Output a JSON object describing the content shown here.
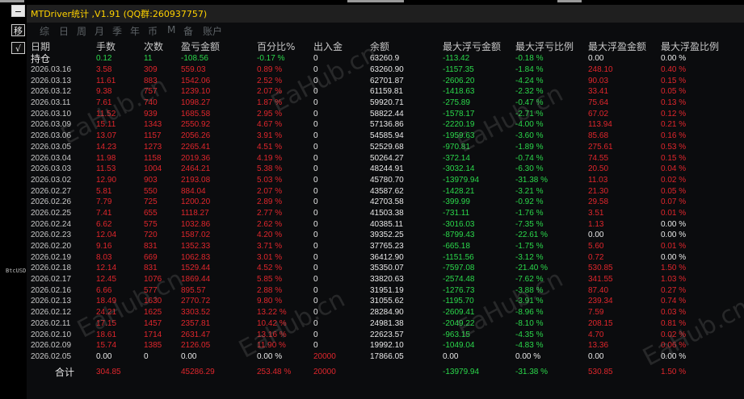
{
  "window": {
    "title": "MTDriver统计 ,V1.91 (QQ群:260937757)",
    "left_buttons": [
      "−",
      "移",
      "√"
    ]
  },
  "tabs": [
    "综",
    "日",
    "周",
    "月",
    "季",
    "年",
    "币",
    "M",
    "备",
    "账户"
  ],
  "columns": [
    "日期",
    "手数",
    "次数",
    "盈亏金额",
    "百分比%",
    "出入金",
    "余额",
    "最大浮亏金额",
    "最大浮亏比例",
    "最大浮盈金额",
    "最大浮盈比例"
  ],
  "holding": {
    "label": "持仓",
    "lots": "0.12",
    "count": "11",
    "pnl": "-108.56",
    "pct": "-0.17 %",
    "inout": "0",
    "balance": "63260.9",
    "max_loss": "-113.42",
    "max_loss_pct": "-0.18 %",
    "max_profit": "0.00",
    "max_profit_pct": "0.00 %"
  },
  "rows": [
    {
      "date": "2026.03.16",
      "lots": "3.58",
      "count": "309",
      "pnl": "559.03",
      "pct": "0.89 %",
      "inout": "0",
      "balance": "63260.90",
      "max_loss": "-1157.35",
      "max_loss_pct": "-1.84 %",
      "max_profit": "248.10",
      "max_profit_pct": "0.40 %"
    },
    {
      "date": "2026.03.13",
      "lots": "11.61",
      "count": "883",
      "pnl": "1542.06",
      "pct": "2.52 %",
      "inout": "0",
      "balance": "62701.87",
      "max_loss": "-2606.20",
      "max_loss_pct": "-4.24 %",
      "max_profit": "90.03",
      "max_profit_pct": "0.15 %"
    },
    {
      "date": "2026.03.12",
      "lots": "9.38",
      "count": "757",
      "pnl": "1239.10",
      "pct": "2.07 %",
      "inout": "0",
      "balance": "61159.81",
      "max_loss": "-1418.63",
      "max_loss_pct": "-2.32 %",
      "max_profit": "33.41",
      "max_profit_pct": "0.05 %"
    },
    {
      "date": "2026.03.11",
      "lots": "7.61",
      "count": "740",
      "pnl": "1098.27",
      "pct": "1.87 %",
      "inout": "0",
      "balance": "59920.71",
      "max_loss": "-275.89",
      "max_loss_pct": "-0.47 %",
      "max_profit": "75.64",
      "max_profit_pct": "0.13 %"
    },
    {
      "date": "2026.03.10",
      "lots": "11.52",
      "count": "939",
      "pnl": "1685.58",
      "pct": "2.95 %",
      "inout": "0",
      "balance": "58822.44",
      "max_loss": "-1578.17",
      "max_loss_pct": "-2.71 %",
      "max_profit": "67.02",
      "max_profit_pct": "0.12 %"
    },
    {
      "date": "2026.03.09",
      "lots": "15.11",
      "count": "1343",
      "pnl": "2550.92",
      "pct": "4.67 %",
      "inout": "0",
      "balance": "57136.86",
      "max_loss": "-2220.19",
      "max_loss_pct": "-4.00 %",
      "max_profit": "113.94",
      "max_profit_pct": "0.21 %"
    },
    {
      "date": "2026.03.06",
      "lots": "13.07",
      "count": "1157",
      "pnl": "2056.26",
      "pct": "3.91 %",
      "inout": "0",
      "balance": "54585.94",
      "max_loss": "-1959.63",
      "max_loss_pct": "-3.60 %",
      "max_profit": "85.68",
      "max_profit_pct": "0.16 %"
    },
    {
      "date": "2026.03.05",
      "lots": "14.23",
      "count": "1273",
      "pnl": "2265.41",
      "pct": "4.51 %",
      "inout": "0",
      "balance": "52529.68",
      "max_loss": "-970.81",
      "max_loss_pct": "-1.89 %",
      "max_profit": "275.61",
      "max_profit_pct": "0.53 %"
    },
    {
      "date": "2026.03.04",
      "lots": "11.98",
      "count": "1158",
      "pnl": "2019.36",
      "pct": "4.19 %",
      "inout": "0",
      "balance": "50264.27",
      "max_loss": "-372.14",
      "max_loss_pct": "-0.74 %",
      "max_profit": "74.55",
      "max_profit_pct": "0.15 %"
    },
    {
      "date": "2026.03.03",
      "lots": "11.53",
      "count": "1004",
      "pnl": "2464.21",
      "pct": "5.38 %",
      "inout": "0",
      "balance": "48244.91",
      "max_loss": "-3032.14",
      "max_loss_pct": "-6.30 %",
      "max_profit": "20.50",
      "max_profit_pct": "0.04 %"
    },
    {
      "date": "2026.03.02",
      "lots": "12.90",
      "count": "903",
      "pnl": "2193.08",
      "pct": "5.03 %",
      "inout": "0",
      "balance": "45780.70",
      "max_loss": "-13979.94",
      "max_loss_pct": "-31.38 %",
      "max_profit": "11.03",
      "max_profit_pct": "0.02 %"
    },
    {
      "date": "2026.02.27",
      "lots": "5.81",
      "count": "550",
      "pnl": "884.04",
      "pct": "2.07 %",
      "inout": "0",
      "balance": "43587.62",
      "max_loss": "-1428.21",
      "max_loss_pct": "-3.21 %",
      "max_profit": "21.30",
      "max_profit_pct": "0.05 %"
    },
    {
      "date": "2026.02.26",
      "lots": "7.79",
      "count": "725",
      "pnl": "1200.20",
      "pct": "2.89 %",
      "inout": "0",
      "balance": "42703.58",
      "max_loss": "-399.99",
      "max_loss_pct": "-0.92 %",
      "max_profit": "29.58",
      "max_profit_pct": "0.07 %"
    },
    {
      "date": "2026.02.25",
      "lots": "7.41",
      "count": "655",
      "pnl": "1118.27",
      "pct": "2.77 %",
      "inout": "0",
      "balance": "41503.38",
      "max_loss": "-731.11",
      "max_loss_pct": "-1.76 %",
      "max_profit": "3.51",
      "max_profit_pct": "0.01 %"
    },
    {
      "date": "2026.02.24",
      "lots": "6.62",
      "count": "575",
      "pnl": "1032.86",
      "pct": "2.62 %",
      "inout": "0",
      "balance": "40385.11",
      "max_loss": "-3016.03",
      "max_loss_pct": "-7.35 %",
      "max_profit": "1.13",
      "max_profit_pct": "0.00 %"
    },
    {
      "date": "2026.02.23",
      "lots": "12.04",
      "count": "720",
      "pnl": "1587.02",
      "pct": "4.20 %",
      "inout": "0",
      "balance": "39352.25",
      "max_loss": "-8799.43",
      "max_loss_pct": "-22.61 %",
      "max_profit": "0.00",
      "max_profit_pct": "0.00 %"
    },
    {
      "date": "2026.02.20",
      "lots": "9.16",
      "count": "831",
      "pnl": "1352.33",
      "pct": "3.71 %",
      "inout": "0",
      "balance": "37765.23",
      "max_loss": "-665.18",
      "max_loss_pct": "-1.75 %",
      "max_profit": "5.60",
      "max_profit_pct": "0.01 %"
    },
    {
      "date": "2026.02.19",
      "lots": "8.03",
      "count": "669",
      "pnl": "1062.83",
      "pct": "3.01 %",
      "inout": "0",
      "balance": "36412.90",
      "max_loss": "-1151.56",
      "max_loss_pct": "-3.12 %",
      "max_profit": "0.72",
      "max_profit_pct": "0.00 %"
    },
    {
      "date": "2026.02.18",
      "lots": "12.14",
      "count": "831",
      "pnl": "1529.44",
      "pct": "4.52 %",
      "inout": "0",
      "balance": "35350.07",
      "max_loss": "-7597.08",
      "max_loss_pct": "-21.40 %",
      "max_profit": "530.85",
      "max_profit_pct": "1.50 %"
    },
    {
      "date": "2026.02.17",
      "lots": "12.45",
      "count": "1076",
      "pnl": "1869.44",
      "pct": "5.85 %",
      "inout": "0",
      "balance": "33820.63",
      "max_loss": "-2574.48",
      "max_loss_pct": "-7.62 %",
      "max_profit": "341.55",
      "max_profit_pct": "1.03 %"
    },
    {
      "date": "2026.02.16",
      "lots": "6.66",
      "count": "577",
      "pnl": "895.57",
      "pct": "2.88 %",
      "inout": "0",
      "balance": "31951.19",
      "max_loss": "-1276.73",
      "max_loss_pct": "-3.88 %",
      "max_profit": "87.40",
      "max_profit_pct": "0.27 %"
    },
    {
      "date": "2026.02.13",
      "lots": "18.49",
      "count": "1630",
      "pnl": "2770.72",
      "pct": "9.80 %",
      "inout": "0",
      "balance": "31055.62",
      "max_loss": "-1195.70",
      "max_loss_pct": "-3.91 %",
      "max_profit": "239.34",
      "max_profit_pct": "0.74 %"
    },
    {
      "date": "2026.02.12",
      "lots": "24.21",
      "count": "1625",
      "pnl": "3303.52",
      "pct": "13.22 %",
      "inout": "0",
      "balance": "28284.90",
      "max_loss": "-2609.41",
      "max_loss_pct": "-8.96 %",
      "max_profit": "7.59",
      "max_profit_pct": "0.03 %"
    },
    {
      "date": "2026.02.11",
      "lots": "17.15",
      "count": "1457",
      "pnl": "2357.81",
      "pct": "10.42 %",
      "inout": "0",
      "balance": "24981.38",
      "max_loss": "-2049.22",
      "max_loss_pct": "-8.10 %",
      "max_profit": "208.15",
      "max_profit_pct": "0.81 %"
    },
    {
      "date": "2026.02.10",
      "lots": "18.61",
      "count": "1714",
      "pnl": "2631.47",
      "pct": "13.16 %",
      "inout": "0",
      "balance": "22623.57",
      "max_loss": "-963.15",
      "max_loss_pct": "-4.35 %",
      "max_profit": "4.70",
      "max_profit_pct": "0.02 %"
    },
    {
      "date": "2026.02.09",
      "lots": "15.74",
      "count": "1385",
      "pnl": "2126.05",
      "pct": "11.90 %",
      "inout": "0",
      "balance": "19992.10",
      "max_loss": "-1049.04",
      "max_loss_pct": "-4.83 %",
      "max_profit": "13.36",
      "max_profit_pct": "0.06 %"
    },
    {
      "date": "2026.02.05",
      "lots": "0.00",
      "count": "0",
      "pnl": "0.00",
      "pct": "0.00 %",
      "inout": "20000",
      "balance": "17866.05",
      "max_loss": "0.00",
      "max_loss_pct": "0.00 %",
      "max_profit": "0.00",
      "max_profit_pct": "0.00 %"
    }
  ],
  "total": {
    "label": "合计",
    "lots": "304.85",
    "pnl": "45286.29",
    "pct": "253.48 %",
    "inout": "20000",
    "max_loss": "-13979.94",
    "max_loss_pct": "-31.38 %",
    "max_profit": "530.85",
    "max_profit_pct": "1.50 %"
  },
  "watermark": "EaHub.cn",
  "left_overlay_text": "BtcUSD",
  "colors": {
    "title": "#ffd200",
    "header": "#c8c8c8",
    "date": "#c8c8c8",
    "red": "#e0262c",
    "green": "#2bd84b",
    "white": "#e8e8e8",
    "muted_tab": "#5d6266",
    "panel_bg": "#0b0c0e",
    "titlebar_bg": "#1f1f1f"
  }
}
